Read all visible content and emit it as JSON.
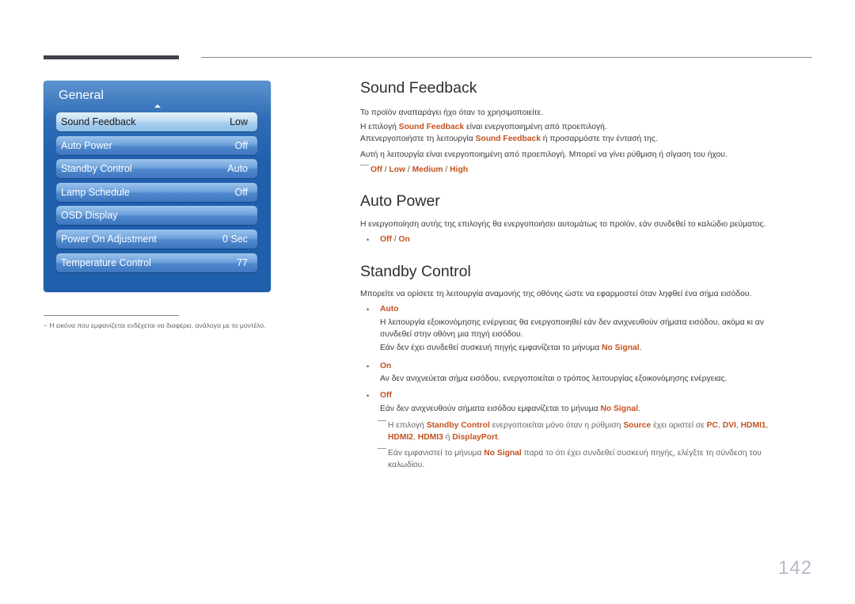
{
  "osd": {
    "title": "General",
    "items": [
      {
        "label": "Sound Feedback",
        "value": "Low",
        "selected": true
      },
      {
        "label": "Auto Power",
        "value": "Off",
        "selected": false
      },
      {
        "label": "Standby Control",
        "value": "Auto",
        "selected": false
      },
      {
        "label": "Lamp Schedule",
        "value": "Off",
        "selected": false
      },
      {
        "label": "OSD Display",
        "value": "",
        "selected": false
      },
      {
        "label": "Power On Adjustment",
        "value": "0 Sec",
        "selected": false
      },
      {
        "label": "Temperature Control",
        "value": "77",
        "selected": false
      }
    ]
  },
  "footnote": "− Η εικόνα που εμφανίζεται ενδέχεται να διαφέρει, ανάλογα με το μοντέλο.",
  "sound_feedback": {
    "title": "Sound Feedback",
    "p1": "Το προϊόν αναπαράγει ήχο όταν το χρησιμοποιείτε.",
    "p2_pre": "Η επιλογή ",
    "p2_hl": "Sound Feedback",
    "p2_post": " είναι ενεργοποιημένη από προεπιλογή.",
    "p3_pre": "Απενεργοποιήστε τη λειτουργία ",
    "p3_hl": "Sound Feedback",
    "p3_post": " ή προσαρμόστε την έντασή της.",
    "p4": "Αυτή η λειτουργία είναι ενεργοποιημένη από προεπιλογή. Μπορεί να γίνει ρύθμιση ή σίγαση του ήχου.",
    "options": [
      "Off",
      "Low",
      "Medium",
      "High"
    ],
    "separator": " / "
  },
  "auto_power": {
    "title": "Auto Power",
    "p1": "Η ενεργοποίηση αυτής της επιλογής θα ενεργοποιήσει αυτομάτως το προϊόν, εάν συνδεθεί το καλώδιο ρεύματος.",
    "options": [
      "Off",
      "On"
    ],
    "bullet": "•"
  },
  "standby_control": {
    "title": "Standby Control",
    "p1": "Μπορείτε να ορίσετε τη λειτουργία αναμονής της οθόνης ώστε να εφαρμοστεί όταν ληφθεί ένα σήμα εισόδου.",
    "auto_label": "Auto",
    "auto_desc1": "Η λειτουργία εξοικονόμησης ενέργειας θα ενεργοποιηθεί εάν δεν ανιχνευθούν σήματα εισόδου, ακόμα κι αν",
    "auto_desc2": "συνδεθεί στην οθόνη μια πηγή εισόδου.",
    "auto_desc3_pre": "Εάν δεν έχει συνδεθεί συσκευή πηγής εμφανίζεται το μήνυμα ",
    "no_signal": "No Signal",
    "period": ".",
    "on_label": "On",
    "on_desc": "Αν δεν ανιχνεύεται σήμα εισόδου, ενεργοποιείται ο τρόπος λειτουργίας εξοικονόμησης ενέργειας.",
    "off_label": "Off",
    "off_desc_pre": "Εάν δεν ανιχνευθούν σήματα εισόδου εμφανίζεται το μήνυμα ",
    "note1_pre": "Η επιλογή ",
    "note1_hl1": "Standby Control",
    "note1_mid": " ενεργοποιείται μόνο όταν η ρύθμιση ",
    "note1_hl2": "Source",
    "note1_mid2": " έχει οριστεί σε ",
    "sources": [
      "PC",
      "DVI",
      "HDMI1",
      "HDMI2",
      "HDMI3",
      "DisplayPort"
    ],
    "comma": ", ",
    "or": " ή ",
    "note2_pre": "Εάν εμφανιστεί το μήνυμα ",
    "note2_post1": " παρά το ότι έχει συνδεθεί συσκευή πηγής, ελέγξτε τη σύνδεση του",
    "note2_post2": "καλωδίου."
  },
  "page_number": "142"
}
